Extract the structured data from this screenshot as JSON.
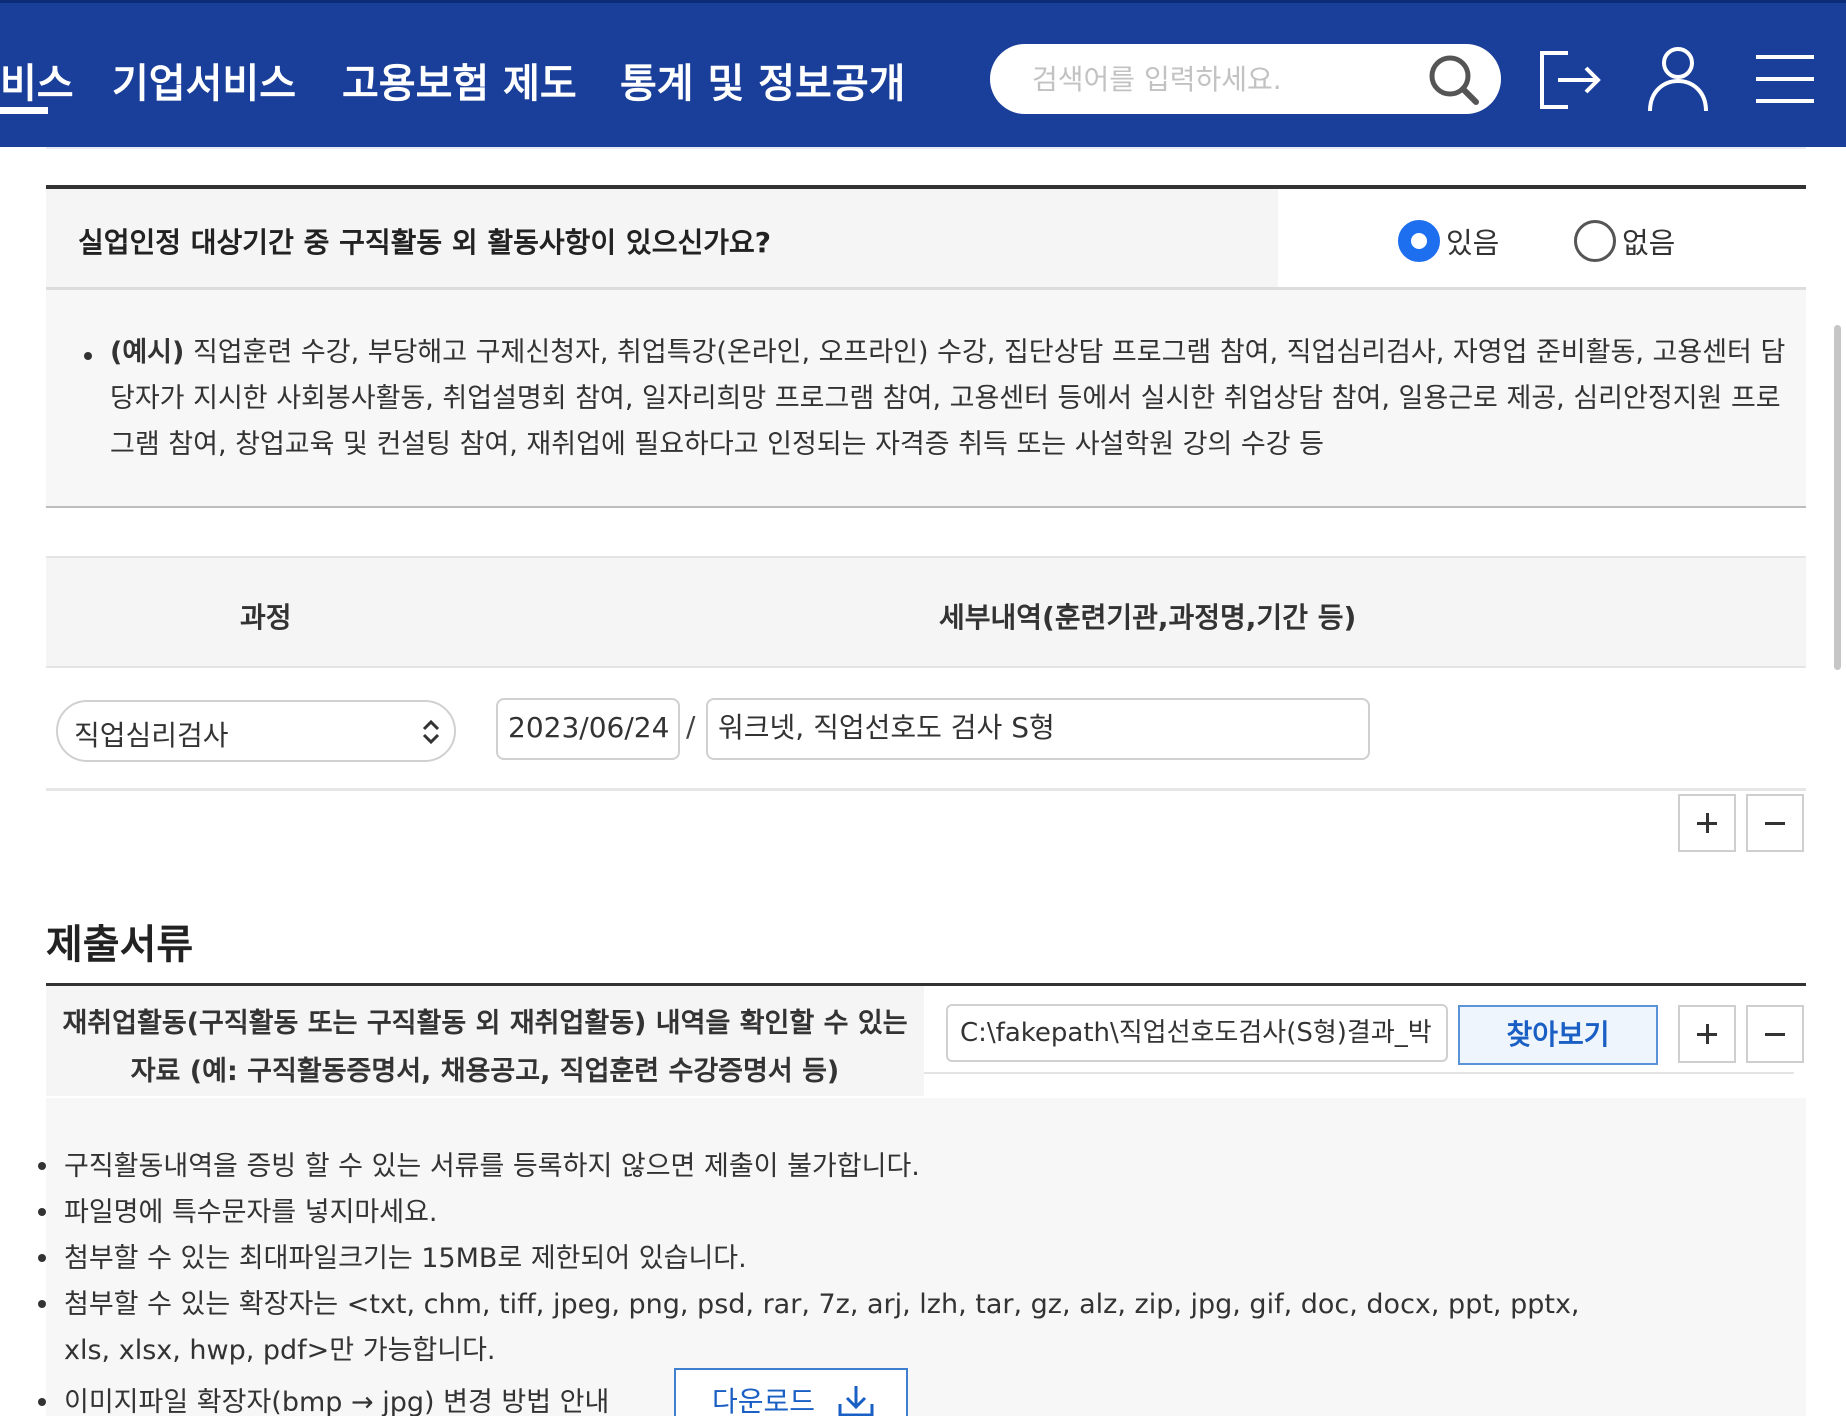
{
  "header": {
    "nav": [
      {
        "label": "비스"
      },
      {
        "label": "기업서비스"
      },
      {
        "label": "고용보험 제도"
      },
      {
        "label": "통계 및 정보공개"
      }
    ],
    "search_placeholder": "검색어를 입력하세요.",
    "icons": [
      "search-icon",
      "logout-icon",
      "user-icon",
      "menu-icon"
    ]
  },
  "question": {
    "text": "실업인정 대상기간 중 구직활동 외 활동사항이 있으신가요?",
    "options": [
      {
        "label": "있음",
        "selected": true
      },
      {
        "label": "없음",
        "selected": false
      }
    ]
  },
  "example": {
    "prefix": "(예시)",
    "text": " 직업훈련 수강, 부당해고 구제신청자, 취업특강(온라인, 오프라인) 수강, 집단상담 프로그램 참여, 직업심리검사, 자영업 준비활동, 고용센터 담당자가 지시한 사회봉사활동, 취업설명회 참여, 일자리희망 프로그램 참여, 고용센터 등에서 실시한 취업상담 참여, 일용근로 제공, 심리안정지원 프로그램 참여, 창업교육 및 컨설팅 참여, 재취업에 필요하다고 인정되는 자격증 취득 또는 사설학원 강의 수강 등"
  },
  "table": {
    "headers": [
      "과정",
      "세부내역(훈련기관,과정명,기간 등)"
    ],
    "row": {
      "course": "직업심리검사",
      "date": "2023/06/24",
      "separator": "/",
      "detail": "워크넷, 직업선호도 검사 S형"
    }
  },
  "documents": {
    "title": "제출서류",
    "label_line1": "재취업활동(구직활동 또는 구직활동 외 재취업활동) 내역을 확인할 수 있는",
    "label_line2": "자료 (예: 구직활동증명서, 채용공고, 직업훈련 수강증명서 등)",
    "file_value": "C:\\fakepath\\직업선호도검사(S형)결과_박",
    "browse_label": "찾아보기",
    "notes": [
      "구직활동내역을 증빙 할 수 있는 서류를 등록하지 않으면 제출이 불가합니다.",
      "파일명에 특수문자를 넣지마세요.",
      "첨부할 수 있는 최대파일크기는 15MB로 제한되어 있습니다.",
      "첨부할 수 있는 확장자는 <txt, chm, tiff, jpeg, png, psd, rar, 7z, arj, lzh, tar, gz, alz, zip, jpg, gif, doc, docx, ppt, pptx,",
      "xls, xlsx, hwp, pdf>만 가능합니다.",
      "이미지파일 확장자(bmp → jpg) 변경 방법 안내"
    ],
    "download_label": "다운로드"
  },
  "colors": {
    "header_bg": "#1a3f9a",
    "accent": "#1e6ff0",
    "link_blue": "#1a5fc4"
  }
}
